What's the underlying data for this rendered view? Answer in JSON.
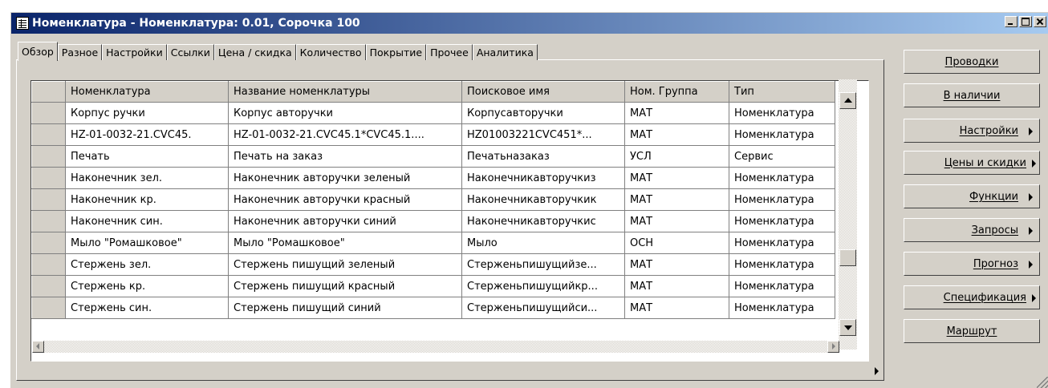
{
  "window": {
    "title": "Номенклатура - Номенклатура: 0.01, Сорочка 100"
  },
  "tabs": [
    {
      "label": "Обзор",
      "active": true
    },
    {
      "label": "Разное"
    },
    {
      "label": "Настройки"
    },
    {
      "label": "Ссылки"
    },
    {
      "label": "Цена / скидка"
    },
    {
      "label": "Количество"
    },
    {
      "label": "Покрытие"
    },
    {
      "label": "Прочее"
    },
    {
      "label": "Аналитика"
    }
  ],
  "grid": {
    "columns": [
      "Номенклатура",
      "Название номенклатуры",
      "Поисковое имя",
      "Ном. Группа",
      "Тип"
    ],
    "rows": [
      [
        "Корпус ручки",
        "Корпус авторучки",
        "Корпусавторучки",
        "МАТ",
        "Номенклатура"
      ],
      [
        "HZ-01-0032-21.CVC45.",
        "HZ-01-0032-21.CVC45.1*CVC45.1....",
        "HZ01003221CVC451*...",
        "МАТ",
        "Номенклатура"
      ],
      [
        "Печать",
        "Печать на заказ",
        "Печатьназаказ",
        "УСЛ",
        "Сервис"
      ],
      [
        "Наконечник зел.",
        "Наконечник авторучки зеленый",
        "Наконечникавторучкиз",
        "МАТ",
        "Номенклатура"
      ],
      [
        "Наконечник кр.",
        "Наконечник авторучки красный",
        "Наконечникавторучкик",
        "МАТ",
        "Номенклатура"
      ],
      [
        "Наконечник син.",
        "Наконечник авторучки синий",
        "Наконечникавторучкис",
        "МАТ",
        "Номенклатура"
      ],
      [
        "Мыло \"Ромашковое\"",
        "Мыло \"Ромашковое\"",
        "Мыло",
        "ОСН",
        "Номенклатура"
      ],
      [
        "Стержень зел.",
        "Стержень пишущий зеленый",
        "Стерженьпишущийзе...",
        "МАТ",
        "Номенклатура"
      ],
      [
        "Стержень кр.",
        "Стержень пишущий красный",
        "Стерженьпишущийкр...",
        "МАТ",
        "Номенклатура"
      ],
      [
        "Стержень син.",
        "Стержень пишущий синий",
        "Стерженьпишущийси...",
        "МАТ",
        "Номенклатура"
      ]
    ]
  },
  "side_buttons": [
    {
      "label": "Проводки",
      "submenu": false
    },
    {
      "label": "В наличии",
      "submenu": false
    },
    {
      "label": "Настройки",
      "submenu": true
    },
    {
      "label": "Цены и скидки",
      "submenu": true
    },
    {
      "label": "Функции",
      "submenu": true
    },
    {
      "label": "Запросы",
      "submenu": true
    },
    {
      "label": "Прогноз",
      "submenu": true
    },
    {
      "label": "Спецификация",
      "submenu": true
    },
    {
      "label": "Маршрут",
      "submenu": false
    }
  ],
  "colors": {
    "titlebar_start": "#0a246a",
    "titlebar_end": "#a6caf0",
    "face": "#d4d0c8"
  },
  "icons": [
    "app-list-icon",
    "minimize-icon",
    "maximize-icon",
    "close-icon",
    "scroll-up-icon",
    "scroll-down-icon",
    "scroll-left-icon",
    "scroll-right-icon",
    "submenu-arrow-icon",
    "size-grip-icon"
  ]
}
